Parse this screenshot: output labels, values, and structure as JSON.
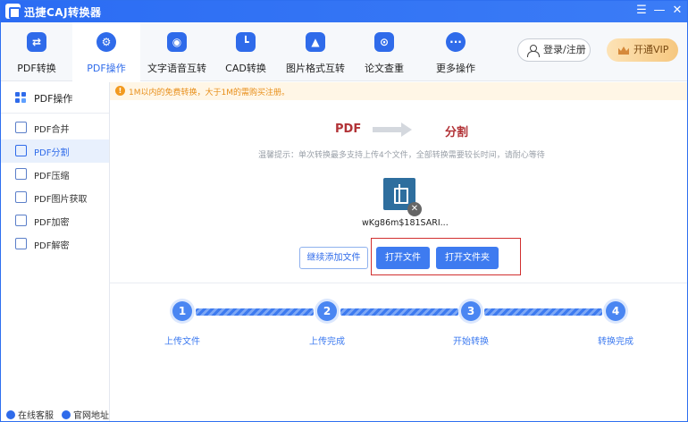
{
  "app": {
    "title": "迅捷CAJ转换器"
  },
  "topnav": {
    "items": [
      {
        "label": "PDF转换",
        "icon": "swap-icon"
      },
      {
        "label": "PDF操作",
        "icon": "gear-icon"
      },
      {
        "label": "文字语音互转",
        "icon": "voice-icon"
      },
      {
        "label": "CAD转换",
        "icon": "cad-icon"
      },
      {
        "label": "图片格式互转",
        "icon": "image-icon"
      },
      {
        "label": "论文查重",
        "icon": "search-doc-icon"
      },
      {
        "label": "更多操作",
        "icon": "more-icon"
      }
    ],
    "login_label": "登录/注册",
    "vip_label": "开通VIP"
  },
  "sidebar": {
    "header": "PDF操作",
    "items": [
      {
        "label": "PDF合并"
      },
      {
        "label": "PDF分割"
      },
      {
        "label": "PDF压缩"
      },
      {
        "label": "PDF图片获取"
      },
      {
        "label": "PDF加密"
      },
      {
        "label": "PDF解密"
      }
    ],
    "footer": {
      "service": "在线客服",
      "website": "官网地址"
    }
  },
  "main": {
    "notice": "1M以内的免费转换，大于1M的需购买注册。",
    "flow": {
      "from": "PDF",
      "to": "分割"
    },
    "hint": "温馨提示：单次转换最多支持上传4个文件，全部转换需要较长时间，请耐心等待",
    "file": {
      "name": "wKg86m$181SARI..."
    },
    "buttons": {
      "add_more": "继续添加文件",
      "open_file": "打开文件",
      "open_folder": "打开文件夹"
    },
    "steps": [
      {
        "num": "1",
        "label": "上传文件"
      },
      {
        "num": "2",
        "label": "上传完成"
      },
      {
        "num": "3",
        "label": "开始转换"
      },
      {
        "num": "4",
        "label": "转换完成"
      }
    ]
  },
  "colors": {
    "accent": "#2f6bea",
    "title_bar": "#2b6cf3",
    "flow_text": "#b23337",
    "highlight": "#d12f2f",
    "notice_text": "#e88f1a"
  }
}
